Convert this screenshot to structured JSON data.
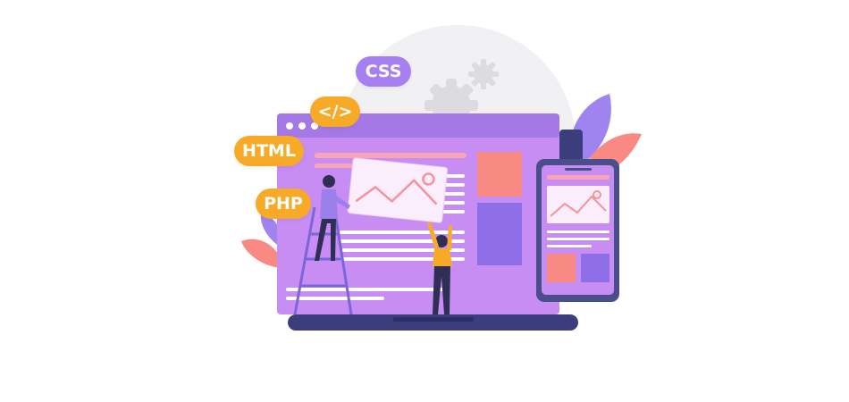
{
  "badges": {
    "css": "CSS",
    "code": "</>",
    "html": "HTML",
    "php": "PHP"
  },
  "icons": [
    "gear-icon",
    "image-icon",
    "leaf-icon"
  ],
  "colors": {
    "screen": "#c78df3",
    "screen_top": "#a479e6",
    "laptop_base": "#3b3d7c",
    "accent_orange": "#f7a928",
    "accent_purple": "#a77ff0",
    "coral": "#f98a83",
    "violet_block": "#8f6fe8",
    "phone_frame": "#4a4e8a"
  }
}
